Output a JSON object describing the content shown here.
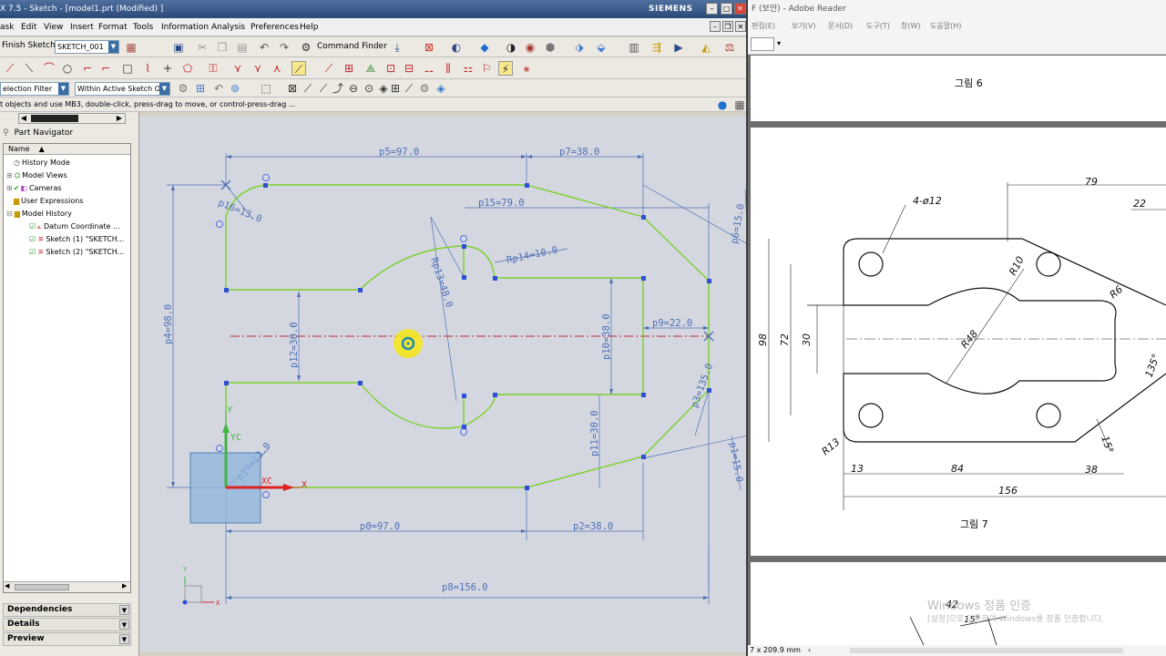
{
  "nx": {
    "window_title": "X 7.5 - Sketch - [model1.prt (Modified) ]",
    "brand": "SIEMENS",
    "menus": [
      "ask",
      "Edit",
      "View",
      "Insert",
      "Format",
      "Tools",
      "Information",
      "Analysis",
      "Preferences",
      "Help"
    ],
    "finish_sketch": "Finish Sketch",
    "sketch_name": "SKETCH_001",
    "command_finder": "Command Finder",
    "selection_filter": "election Filter",
    "scope": "Within Active Sketch O",
    "status_message": "t objects and use MB3, double-click, press-drag to move, or control-press-drag ..."
  },
  "part_navigator": {
    "title": "Part Navigator",
    "column_header": "Name",
    "items": [
      {
        "label": "History Mode"
      },
      {
        "label": "Model Views"
      },
      {
        "label": "Cameras"
      },
      {
        "label": "User Expressions"
      },
      {
        "label": "Model History"
      },
      {
        "label": "Datum Coordinate ..."
      },
      {
        "label": "Sketch (1) \"SKETCH..."
      },
      {
        "label": "Sketch (2) \"SKETCH..."
      }
    ],
    "sections": [
      "Dependencies",
      "Details",
      "Preview"
    ]
  },
  "sketch": {
    "dimensions": {
      "p5": "p5=97.0",
      "p7": "p7=38.0",
      "p16": "p16=13.0",
      "p15": "p15=79.0",
      "p6": "p6=15.0",
      "p14": "Rp14=10.0",
      "p13": "Rp13=48.0",
      "p4": "p4=98.0",
      "p12": "p12=30.0",
      "p10": "p10=38.0",
      "p9": "p9=22.0",
      "p3": "p3=135.0",
      "p11": "p11=30.0",
      "p1": "p1=15.0",
      "p17": "p17=13.0",
      "p0": "p0=97.0",
      "p2": "p2=38.0",
      "p8": "p8=156.0"
    },
    "axis_labels": {
      "y": "Y",
      "yc": "YC",
      "xc": "XC",
      "x": "X"
    },
    "colors": {
      "geometry": "#7bd12a",
      "dimension": "#4d6fb5",
      "point": "#2f4fd8",
      "highlight": "#f5e61e"
    }
  },
  "reader": {
    "title": "F (보안) - Adobe Reader",
    "menus": [
      "편집(E)",
      "보기(V)",
      "문서(D)",
      "도구(T)",
      "창(W)",
      "도움말(H)"
    ],
    "fig6_caption": "그림 6",
    "fig7_caption": "그림 7",
    "drawing_dims": {
      "d79": "79",
      "d22": "22",
      "holes": "4-ø12",
      "r10": "R10",
      "r6": "R6",
      "d98": "98",
      "d72": "72",
      "d30": "30",
      "r48": "R48",
      "d135": "135°",
      "r13": "R13",
      "d15deg": "15°",
      "d13": "13",
      "d84": "84",
      "d38": "38",
      "d156": "156"
    },
    "next_page": {
      "d42": "42",
      "d15": "15°"
    },
    "watermark_line1": "Windows 정품 인증",
    "watermark_line2": "[설정]으로 이동하여 Windows를 정품 인증합니다.",
    "page_size": "7 x 209.9 mm"
  }
}
